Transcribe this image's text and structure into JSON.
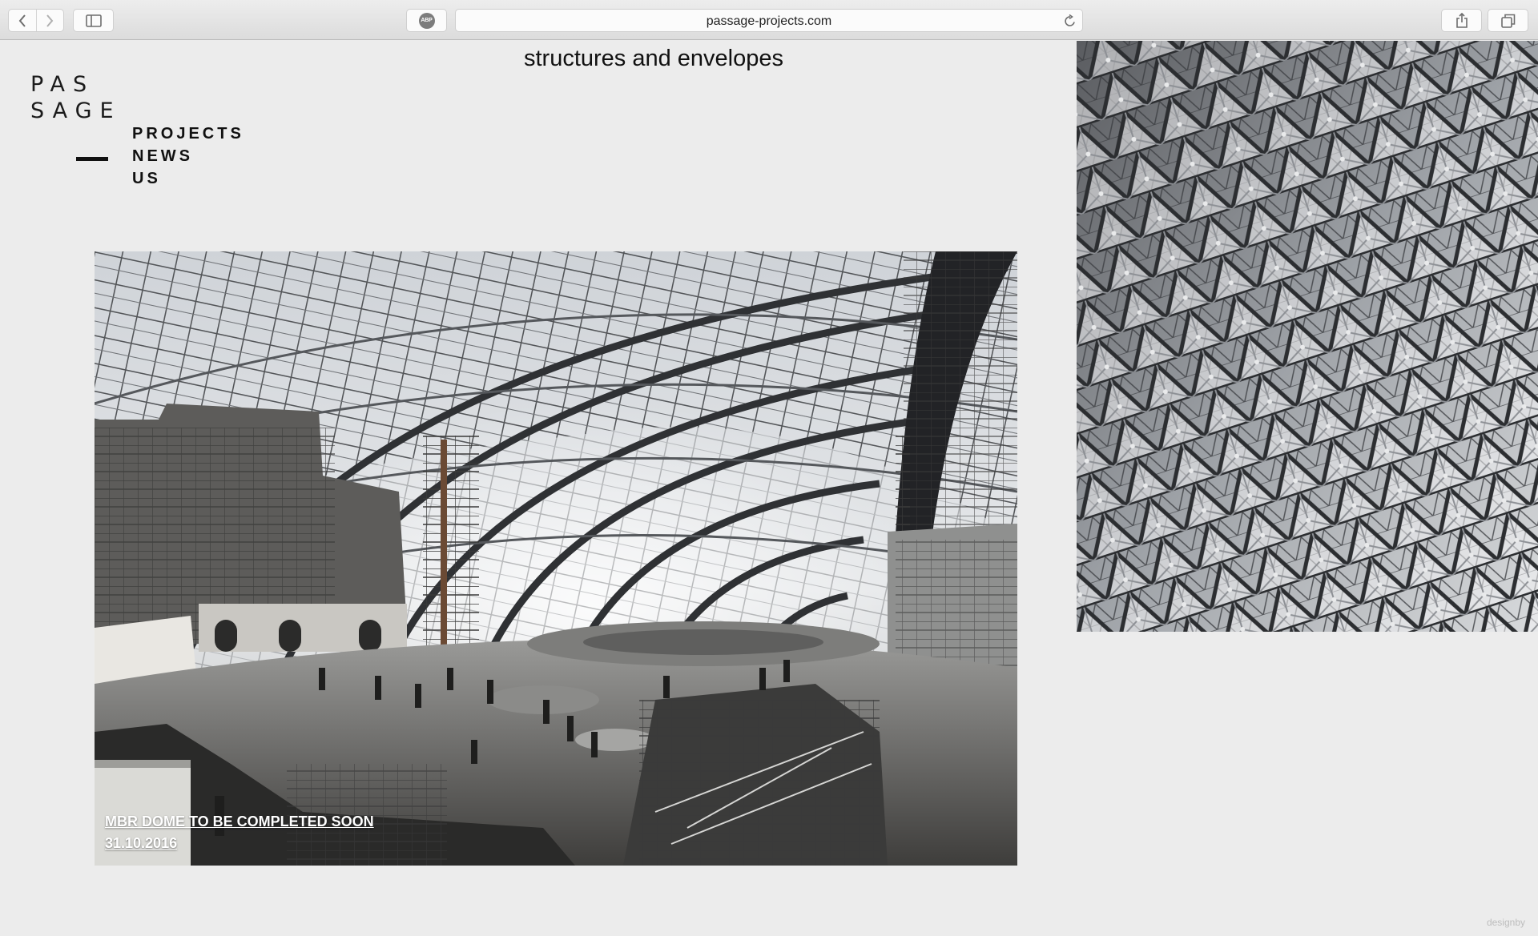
{
  "browser": {
    "url": "passage-projects.com",
    "adblock_label": "ABP",
    "icons": [
      "back-icon",
      "forward-icon",
      "sidebar-icon",
      "adblock-icon",
      "reload-icon",
      "share-icon",
      "tabs-icon"
    ]
  },
  "site": {
    "logo_line1": "PAS",
    "logo_line2": "SAGE",
    "nav": [
      {
        "label": "PROJECTS"
      },
      {
        "label": "NEWS"
      },
      {
        "label": "US"
      }
    ],
    "page_title": "structures and envelopes"
  },
  "hero": {
    "headline": "MBR DOME TO BE COMPLETED SOON",
    "date": "31.10.2016"
  },
  "footer": {
    "credit": "designby"
  },
  "colors": {
    "background": "#ececec",
    "text": "#111111",
    "chrome": "#e3e3e3"
  }
}
